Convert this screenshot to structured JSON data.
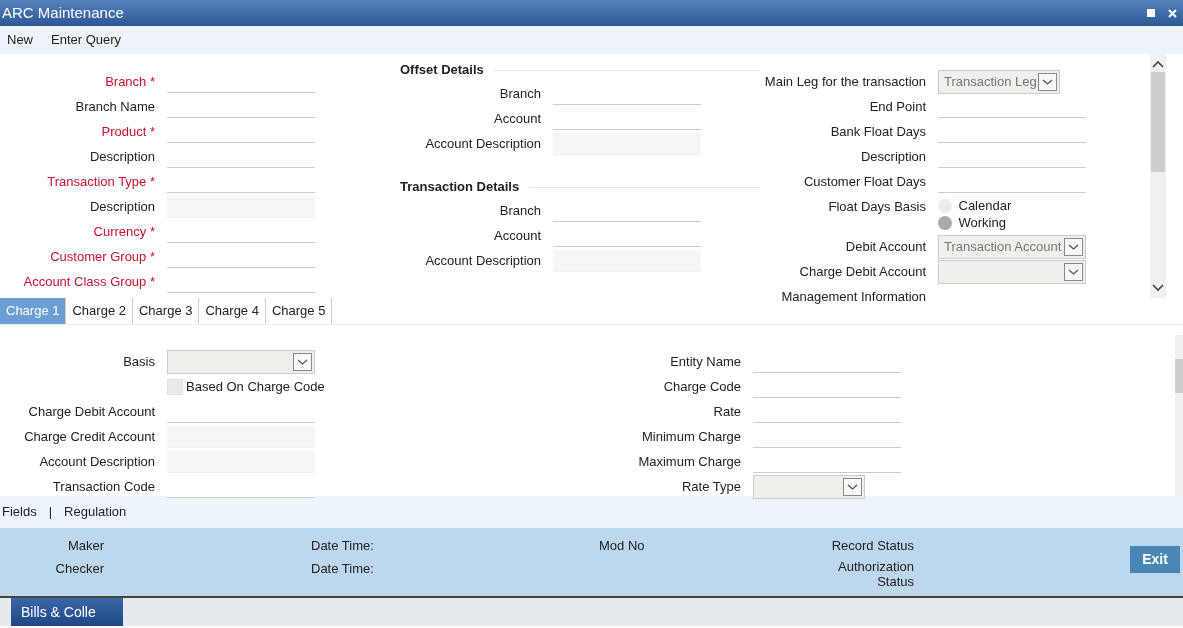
{
  "window": {
    "title": "ARC Maintenance"
  },
  "toolbar": [
    "New",
    "Enter Query"
  ],
  "main_fields": [
    {
      "label": "Branch *",
      "required": true,
      "kind": "text"
    },
    {
      "label": "Branch Name",
      "required": false,
      "kind": "text"
    },
    {
      "label": "Product *",
      "required": true,
      "kind": "text"
    },
    {
      "label": "Description",
      "required": false,
      "kind": "text"
    },
    {
      "label": "Transaction Type *",
      "required": true,
      "kind": "text"
    },
    {
      "label": "Description",
      "required": false,
      "kind": "readonly"
    },
    {
      "label": "Currency *",
      "required": true,
      "kind": "text"
    },
    {
      "label": "Customer Group *",
      "required": true,
      "kind": "text"
    },
    {
      "label": "Account Class Group *",
      "required": true,
      "kind": "text"
    }
  ],
  "offset_details": {
    "title": "Offset Details",
    "fields": [
      {
        "label": "Branch",
        "required": false,
        "kind": "text"
      },
      {
        "label": "Account",
        "required": false,
        "kind": "text"
      },
      {
        "label": "Account Description",
        "required": false,
        "kind": "readonly"
      }
    ]
  },
  "transaction_details": {
    "title": "Transaction Details",
    "fields": [
      {
        "label": "Branch",
        "required": false,
        "kind": "text"
      },
      {
        "label": "Account",
        "required": false,
        "kind": "text"
      },
      {
        "label": "Account Description",
        "required": false,
        "kind": "readonly"
      }
    ]
  },
  "leg_fields": [
    {
      "label": "Main Leg for the transaction",
      "required": false,
      "kind": "select",
      "value": "Transaction Leg"
    },
    {
      "label": "End Point",
      "required": false,
      "kind": "text"
    },
    {
      "label": "Bank Float Days",
      "required": false,
      "kind": "text"
    },
    {
      "label": "Description",
      "required": false,
      "kind": "text"
    },
    {
      "label": "Customer Float Days",
      "required": false,
      "kind": "text"
    },
    {
      "label": "Float Days Basis",
      "required": false,
      "kind": "radio",
      "options": [
        {
          "label": "Calendar",
          "selected": false
        },
        {
          "label": "Working",
          "selected": true
        }
      ]
    },
    {
      "label": "Debit Account",
      "required": false,
      "kind": "select",
      "value": "Transaction Account"
    },
    {
      "label": "Charge Debit Account",
      "required": false,
      "kind": "select"
    },
    {
      "label": "Management Information",
      "required": false,
      "kind": "none"
    }
  ],
  "charge_tabs": [
    {
      "label": "Charge 1",
      "selected": true
    },
    {
      "label": "Charge 2",
      "selected": false
    },
    {
      "label": "Charge 3",
      "selected": false
    },
    {
      "label": "Charge 4",
      "selected": false
    },
    {
      "label": "Charge 5",
      "selected": false
    }
  ],
  "charge_left": [
    {
      "label": "Basis",
      "required": false,
      "kind": "select"
    },
    {
      "label": "Based On Charge Code",
      "kind": "checkbox",
      "checked": false
    },
    {
      "label": "Charge Debit Account",
      "required": false,
      "kind": "text"
    },
    {
      "label": "Charge Credit Account",
      "required": false,
      "kind": "readonly"
    },
    {
      "label": "Account Description",
      "required": false,
      "kind": "readonly"
    },
    {
      "label": "Transaction Code",
      "required": false,
      "kind": "text"
    }
  ],
  "charge_right": [
    {
      "label": "Entity Name",
      "required": false,
      "kind": "text"
    },
    {
      "label": "Charge Code",
      "required": false,
      "kind": "text"
    },
    {
      "label": "Rate",
      "required": false,
      "kind": "text"
    },
    {
      "label": "Minimum Charge",
      "required": false,
      "kind": "text"
    },
    {
      "label": "Maximum Charge",
      "required": false,
      "kind": "text"
    },
    {
      "label": "Rate Type",
      "required": false,
      "kind": "select-short"
    }
  ],
  "links": {
    "items": [
      "Fields",
      "Regulation"
    ],
    "separator": "|"
  },
  "audit": {
    "maker": "Maker",
    "maker_date": "Date Time:",
    "mod_no": "Mod No",
    "record_status": "Record Status",
    "checker": "Checker",
    "checker_date": "Date Time:",
    "authorization_status": "Authorization Status"
  },
  "exit_button": "Exit",
  "taskbar": {
    "button": "Bills & Colle"
  }
}
